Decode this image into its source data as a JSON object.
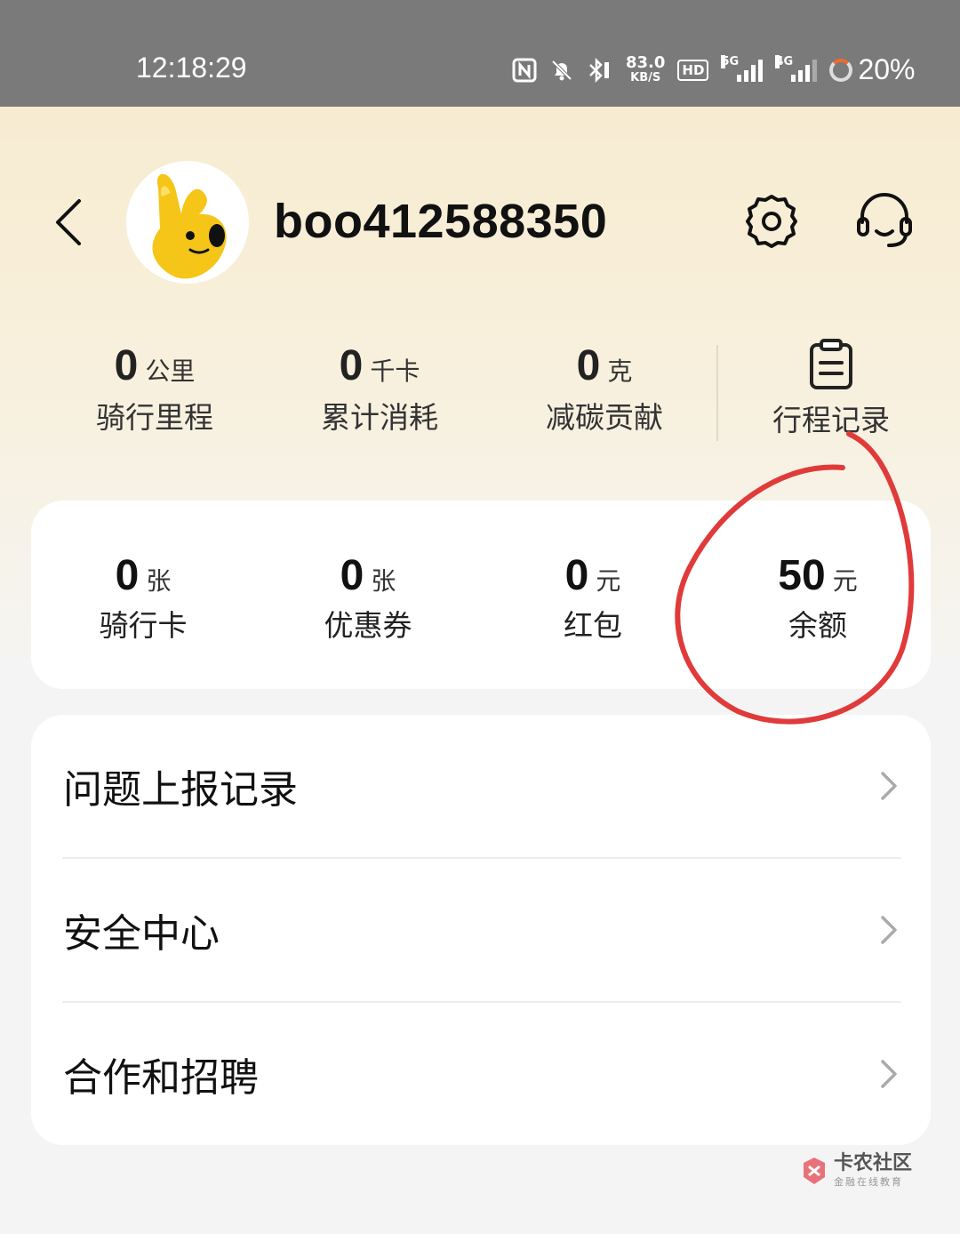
{
  "status_bar": {
    "time": "12:18:29",
    "net_speed_value": "83.0",
    "net_speed_unit": "KB/S",
    "hd_label": "HD",
    "network_1": "5G",
    "network_2": "4G",
    "battery": "20%",
    "icons": [
      "nfc-icon",
      "bell-off-icon",
      "bluetooth-icon",
      "hd-icon",
      "signal-5g-icon",
      "signal-4g-icon",
      "battery-icon"
    ]
  },
  "profile": {
    "username": "boo412588350",
    "icons": [
      "back-icon",
      "avatar",
      "settings-icon",
      "customer-service-icon"
    ]
  },
  "stats": [
    {
      "value": "0",
      "unit": "公里",
      "label": "骑行里程"
    },
    {
      "value": "0",
      "unit": "千卡",
      "label": "累计消耗"
    },
    {
      "value": "0",
      "unit": "克",
      "label": "减碳贡献"
    }
  ],
  "trip_record": {
    "label": "行程记录",
    "icon": "clipboard-icon"
  },
  "wallet": [
    {
      "value": "0",
      "unit": "张",
      "label": "骑行卡"
    },
    {
      "value": "0",
      "unit": "张",
      "label": "优惠券"
    },
    {
      "value": "0",
      "unit": "元",
      "label": "红包"
    },
    {
      "value": "50",
      "unit": "元",
      "label": "余额"
    }
  ],
  "menu": [
    {
      "label": "问题上报记录"
    },
    {
      "label": "安全中心"
    },
    {
      "label": "合作和招聘"
    }
  ],
  "watermark": {
    "title": "卡农社区",
    "subtitle": "金融在线教育"
  },
  "colors": {
    "header_gradient_top": "#f7ecd2",
    "annotation_red": "#e03a3a",
    "status_bar": "#7a7a7a",
    "avatar_yellow": "#f5c518"
  }
}
